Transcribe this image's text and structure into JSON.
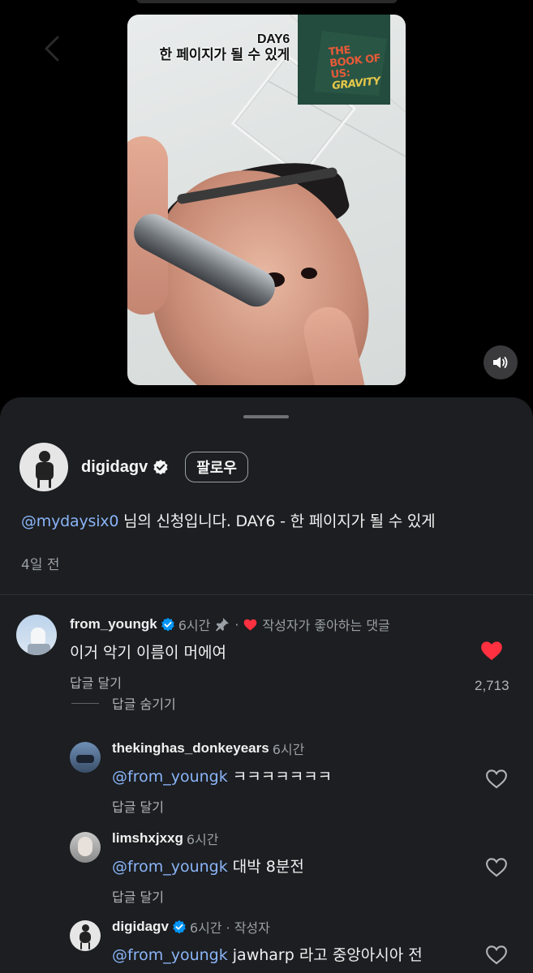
{
  "video": {
    "artist_caption": "DAY6",
    "song_caption": "한 페이지가 될 수 있게",
    "album": {
      "title_lines": [
        "THE",
        "BOOK OF",
        "US:",
        "GRAVITY"
      ]
    }
  },
  "post": {
    "author": "digidagv",
    "follow_label": "팔로우",
    "mention": "@mydaysix0",
    "description": " 님의 신청입니다. DAY6 - 한 페이지가 될 수 있게",
    "posted_ago": "4일 전"
  },
  "comments": {
    "top": {
      "user": "from_youngk",
      "time": "6시간",
      "separator": "·",
      "creator_liked": "작성자가 좋아하는 댓글",
      "text": "이거 악기 이름이 머에여",
      "reply_label": "답글 달기",
      "like_count": "2,713",
      "hide_replies_label": "답글 숨기기"
    },
    "replies": [
      {
        "user": "thekinghas_donkeyears",
        "time": "6시간",
        "mention": "@from_youngk",
        "text": " ㅋㅋㅋㅋㅋㅋㅋ",
        "reply_label": "답글 달기"
      },
      {
        "user": "limshxjxxg",
        "time": "6시간",
        "mention": "@from_youngk",
        "text": " 대박 8분전",
        "reply_label": "답글 달기"
      },
      {
        "user": "digidagv",
        "time": "6시간",
        "author_tag": "· 작성자",
        "mention": "@from_youngk",
        "text": " jawharp 라고 중앙아시아 전"
      }
    ]
  },
  "colors": {
    "background": "#000000",
    "sheet": "#1c1e21",
    "mention": "#8ab4f8",
    "like_red": "#ff3040",
    "muted_text": "#9aa0a6"
  }
}
